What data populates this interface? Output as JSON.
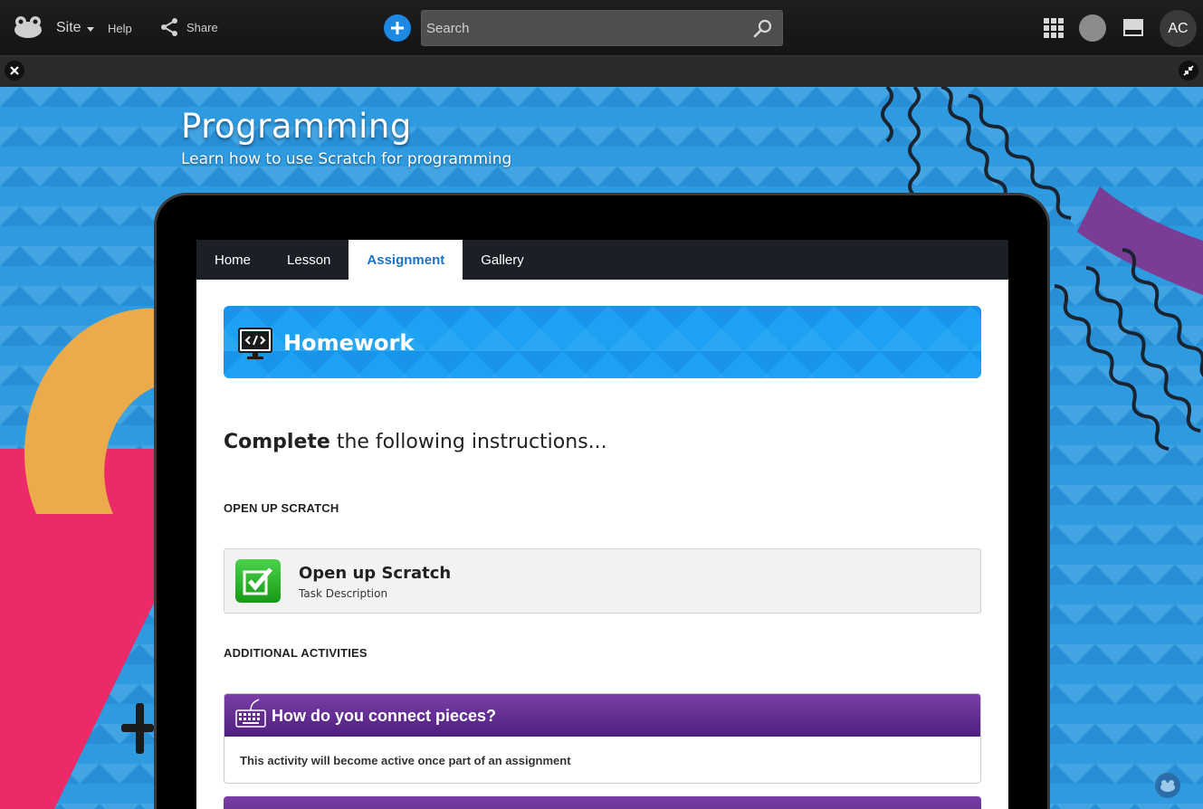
{
  "topbar": {
    "site_label": "Site",
    "help_label": "Help",
    "share_label": "Share",
    "search_placeholder": "Search",
    "avatar_initials": "AC"
  },
  "page": {
    "title": "Programming",
    "subtitle": "Learn how to use Scratch for programming"
  },
  "tabs": [
    {
      "label": "Home",
      "active": false
    },
    {
      "label": "Lesson",
      "active": false
    },
    {
      "label": "Assignment",
      "active": true
    },
    {
      "label": "Gallery",
      "active": false
    }
  ],
  "banner": {
    "title": "Homework",
    "icon": "code-monitor-icon"
  },
  "instructions": {
    "bold": "Complete",
    "rest": " the following instructions..."
  },
  "sections": {
    "open_up": "OPEN UP SCRATCH",
    "additional": "ADDITIONAL ACTIVITIES"
  },
  "task": {
    "title": "Open up Scratch",
    "description": "Task Description"
  },
  "activity": {
    "title": "How do you connect pieces?",
    "body": "This activity will become active once part of an assignment"
  },
  "colors": {
    "accent_blue": "#1a73c8",
    "banner_blue": "#1da1f2",
    "activity_purple": "#5e2a8e",
    "task_green": "#22b022"
  }
}
